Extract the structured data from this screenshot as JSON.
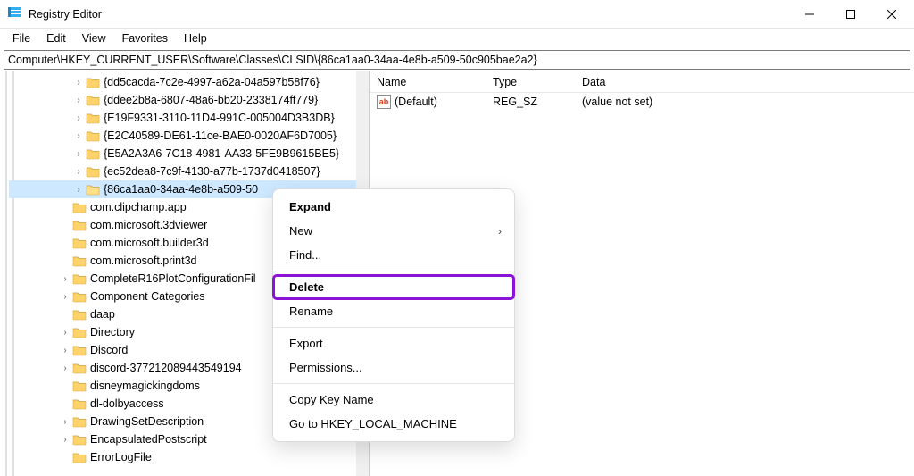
{
  "window": {
    "title": "Registry Editor"
  },
  "menu": {
    "file": "File",
    "edit": "Edit",
    "view": "View",
    "favorites": "Favorites",
    "help": "Help"
  },
  "address": {
    "path": "Computer\\HKEY_CURRENT_USER\\Software\\Classes\\CLSID\\{86ca1aa0-34aa-4e8b-a509-50c905bae2a2}"
  },
  "tree": {
    "items": [
      {
        "label": "{dd5cacda-7c2e-4997-a62a-04a597b58f76}",
        "exp": true,
        "indent": 1
      },
      {
        "label": "{ddee2b8a-6807-48a6-bb20-2338174ff779}",
        "exp": true,
        "indent": 1
      },
      {
        "label": "{E19F9331-3110-11D4-991C-005004D3B3DB}",
        "exp": true,
        "indent": 1
      },
      {
        "label": "{E2C40589-DE61-11ce-BAE0-0020AF6D7005}",
        "exp": true,
        "indent": 1
      },
      {
        "label": "{E5A2A3A6-7C18-4981-AA33-5FE9B9615BE5}",
        "exp": true,
        "indent": 1
      },
      {
        "label": "{ec52dea8-7c9f-4130-a77b-1737d0418507}",
        "exp": true,
        "indent": 1
      },
      {
        "label": "{86ca1aa0-34aa-4e8b-a509-50",
        "exp": true,
        "indent": 1,
        "selected": true,
        "open": true
      },
      {
        "label": "com.clipchamp.app",
        "exp": false,
        "indent": 0
      },
      {
        "label": "com.microsoft.3dviewer",
        "exp": false,
        "indent": 0
      },
      {
        "label": "com.microsoft.builder3d",
        "exp": false,
        "indent": 0
      },
      {
        "label": "com.microsoft.print3d",
        "exp": false,
        "indent": 0
      },
      {
        "label": "CompleteR16PlotConfigurationFil",
        "exp": true,
        "indent": 0
      },
      {
        "label": "Component Categories",
        "exp": true,
        "indent": 0
      },
      {
        "label": "daap",
        "exp": false,
        "indent": 0
      },
      {
        "label": "Directory",
        "exp": true,
        "indent": 0
      },
      {
        "label": "Discord",
        "exp": true,
        "indent": 0
      },
      {
        "label": "discord-377212089443549194",
        "exp": true,
        "indent": 0
      },
      {
        "label": "disneymagickingdoms",
        "exp": false,
        "indent": 0
      },
      {
        "label": "dl-dolbyaccess",
        "exp": false,
        "indent": 0
      },
      {
        "label": "DrawingSetDescription",
        "exp": true,
        "indent": 0
      },
      {
        "label": "EncapsulatedPostscript",
        "exp": true,
        "indent": 0
      },
      {
        "label": "ErrorLogFile",
        "exp": false,
        "indent": 0
      }
    ]
  },
  "list": {
    "headers": {
      "name": "Name",
      "type": "Type",
      "data": "Data"
    },
    "rows": [
      {
        "name": "(Default)",
        "type": "REG_SZ",
        "data": "(value not set)"
      }
    ]
  },
  "context_menu": {
    "expand": "Expand",
    "new": "New",
    "find": "Find...",
    "delete": "Delete",
    "rename": "Rename",
    "export": "Export",
    "permissions": "Permissions...",
    "copy_key": "Copy Key Name",
    "goto": "Go to HKEY_LOCAL_MACHINE"
  }
}
